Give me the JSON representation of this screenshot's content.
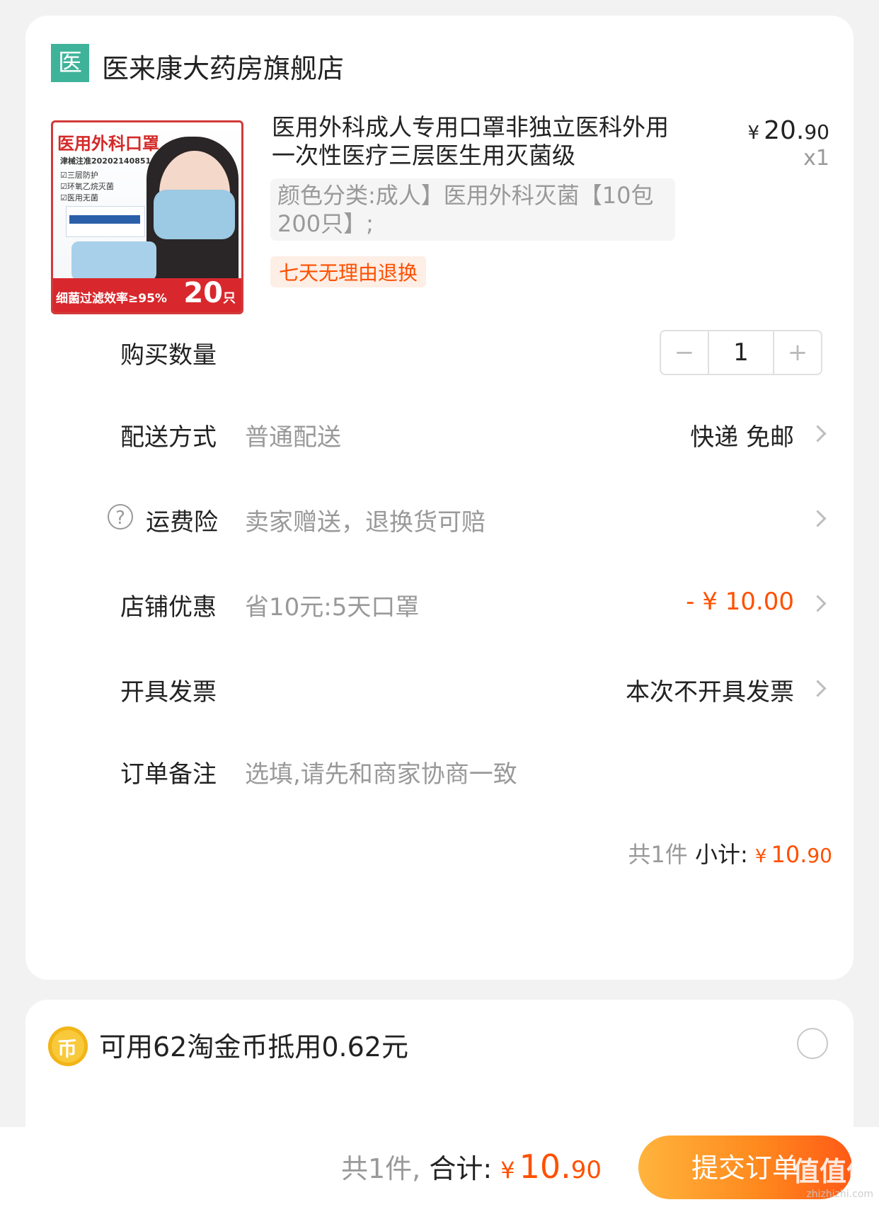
{
  "shop": {
    "logo_char": "医",
    "name": "医来康大药房旗舰店"
  },
  "product": {
    "title": "医用外科成人专用口罩非独立医科外用一次性医疗三层医生用灭菌级",
    "price_currency": "¥",
    "price_main": "20.",
    "price_cents": "90",
    "qty": "x1",
    "sku": "颜色分类:成人】医用外科灭菌【10包200只】;",
    "tag": "七天无理由退换",
    "image": {
      "title": "医用外科口罩",
      "reg": "津械注准20202140851",
      "features": [
        "☑三层防护",
        "☑环氧乙烷灭菌",
        "☑医用无菌"
      ],
      "ribbon_text": "细菌过滤效率≥95%",
      "ribbon_num": "20",
      "ribbon_unit": "只"
    }
  },
  "quantity": {
    "label": "购买数量",
    "value": "1",
    "minus": "−",
    "plus": "+"
  },
  "delivery": {
    "label": "配送方式",
    "value": "普通配送",
    "right": "快递 免邮"
  },
  "insurance": {
    "label": "运费险",
    "value": "卖家赠送，退换货可赔",
    "help": "?"
  },
  "discount": {
    "label": "店铺优惠",
    "value": "省10元:5天口罩",
    "right": "- ¥ 10.00"
  },
  "invoice": {
    "label": "开具发票",
    "right": "本次不开具发票"
  },
  "note": {
    "label": "订单备注",
    "placeholder": "选填,请先和商家协商一致"
  },
  "subtotal": {
    "count": "共1件",
    "label": "小计:",
    "currency": "¥",
    "main": "10.",
    "cents": "90"
  },
  "coins": {
    "icon": "币",
    "text": "可用62淘金币抵用0.62元",
    "selected": false
  },
  "footer": {
    "count": "共1件,",
    "label": "合计:",
    "currency": "¥",
    "main": "10.",
    "cents": "90",
    "submit": "提交订单"
  },
  "watermark": {
    "main": "值值值",
    "sub": "zhizhizhi.com"
  },
  "colors": {
    "accent": "#ff5000",
    "shop_logo": "#3fb39a",
    "coin": "#f8c93a"
  }
}
